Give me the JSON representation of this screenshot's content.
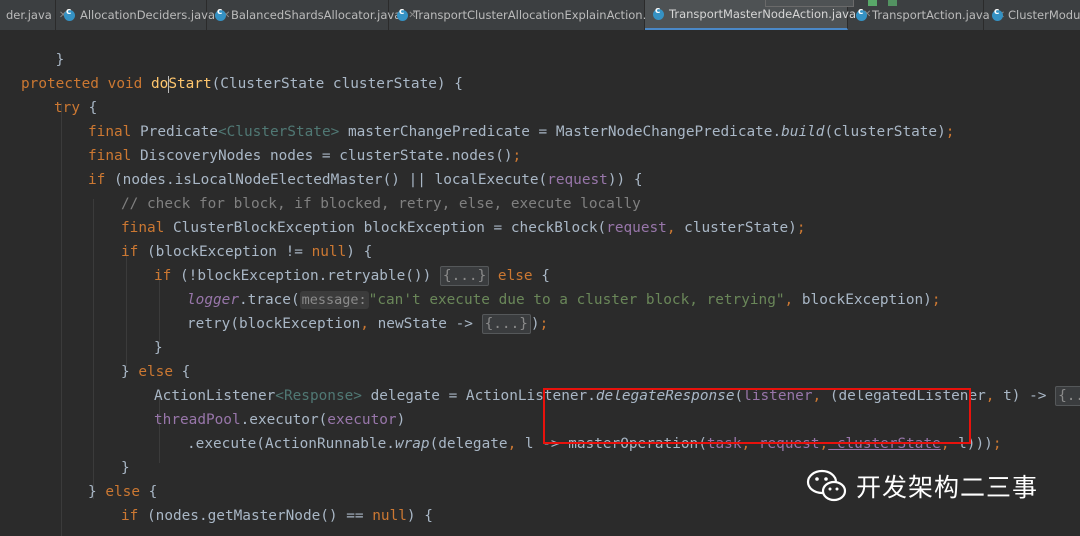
{
  "tabs": [
    {
      "label": "der.java",
      "active": false
    },
    {
      "label": "AllocationDeciders.java",
      "active": false
    },
    {
      "label": "BalancedShardsAllocator.java",
      "active": false
    },
    {
      "label": "TransportClusterAllocationExplainAction.java",
      "active": false
    },
    {
      "label": "TransportMasterNodeAction.java",
      "active": true
    },
    {
      "label": "TransportAction.java",
      "active": false
    },
    {
      "label": "ClusterModule",
      "active": false
    }
  ],
  "code": {
    "l0": {
      "brace": "}"
    },
    "l2": {
      "protected": "protected",
      "void": "void",
      "do": "do",
      "start": "Start",
      "params": "(ClusterState clusterState) {"
    },
    "l3": {
      "try": "try",
      "brace": " {"
    },
    "l4": {
      "final": "final",
      "type": "Predicate",
      "gen": "<ClusterState>",
      "decl": " masterChangePredicate = MasterNodeChangePredicate.",
      "build": "build",
      "arg": "(clusterState)",
      "semi": ";"
    },
    "l5": {
      "final": "final",
      "decl": " DiscoveryNodes nodes = clusterState.nodes()",
      "semi": ";"
    },
    "l6": {
      "if": "if",
      "cond": " (nodes.isLocalNodeElectedMaster() || localExecute(",
      "request": "request",
      "end": ")) {"
    },
    "l7": {
      "comment": "// check for block, if blocked, retry, else, execute locally"
    },
    "l8": {
      "final": "final",
      "decl": " ClusterBlockException blockException = checkBlock(",
      "request": "request",
      "comma": ",",
      "arg": " clusterState)",
      "semi": ";"
    },
    "l9": {
      "if": "if",
      "cond": " (blockException != ",
      "null": "null",
      "end": ") {"
    },
    "l10": {
      "if": "if",
      "cond": " (!blockException.retryable()) ",
      "fold": "{...}",
      "else": "else",
      "brace": " {"
    },
    "l11": {
      "logger": "logger",
      "call": ".trace(",
      "hint": "message:",
      "str": "\"can't execute due to a cluster block, retrying\"",
      "comma": ",",
      "arg": " blockException)",
      "semi": ";"
    },
    "l12": {
      "call": "retry(blockException",
      "comma": ",",
      "arg": " newState -> ",
      "fold": "{...}",
      "end": ")",
      "semi": ";"
    },
    "l13": {
      "brace": "}"
    },
    "l14": {
      "brace": "} ",
      "else": "else",
      "brace2": " {"
    },
    "l15": {
      "type": "ActionListener",
      "gen": "<Response>",
      "decl": " delegate = ActionListener.",
      "method": "delegateResponse",
      "open": "(",
      "listener": "listener",
      "comma": ",",
      "arg": " (delegatedListener",
      "comma2": ",",
      "arg2": " t) -> ",
      "fold": "{...}",
      "end": ")",
      "semi": ";"
    },
    "l16": {
      "pool": "threadPool",
      "call": ".executor(",
      "executor": "executor",
      "end": ")"
    },
    "l17": {
      "pre": ".execute(ActionRunnable.",
      "wrap": "wrap",
      "args": "(delegate",
      "comma": ",",
      "l": " l -> masterOperation(",
      "task": "task",
      "comma2": ",",
      "request": " request",
      "comma3": ",",
      "cs": " clusterState",
      "comma4": ",",
      "end": " l)))",
      "semi": ";"
    },
    "l18": {
      "brace": "}"
    },
    "l19": {
      "brace": "} ",
      "else": "else",
      "brace2": " {"
    },
    "l20": {
      "if": "if",
      "cond": " (nodes.getMasterNode() == ",
      "null": "null",
      "end": ") {"
    }
  },
  "watermark": {
    "text": "开发架构二三事",
    "icon": "wechat-icon"
  },
  "colors": {
    "background": "#2b2b2b",
    "keyword": "#cc7832",
    "method": "#ffc66d",
    "field": "#9876aa",
    "string": "#6a8759",
    "comment": "#808080",
    "highlight_box": "#e8120c"
  }
}
